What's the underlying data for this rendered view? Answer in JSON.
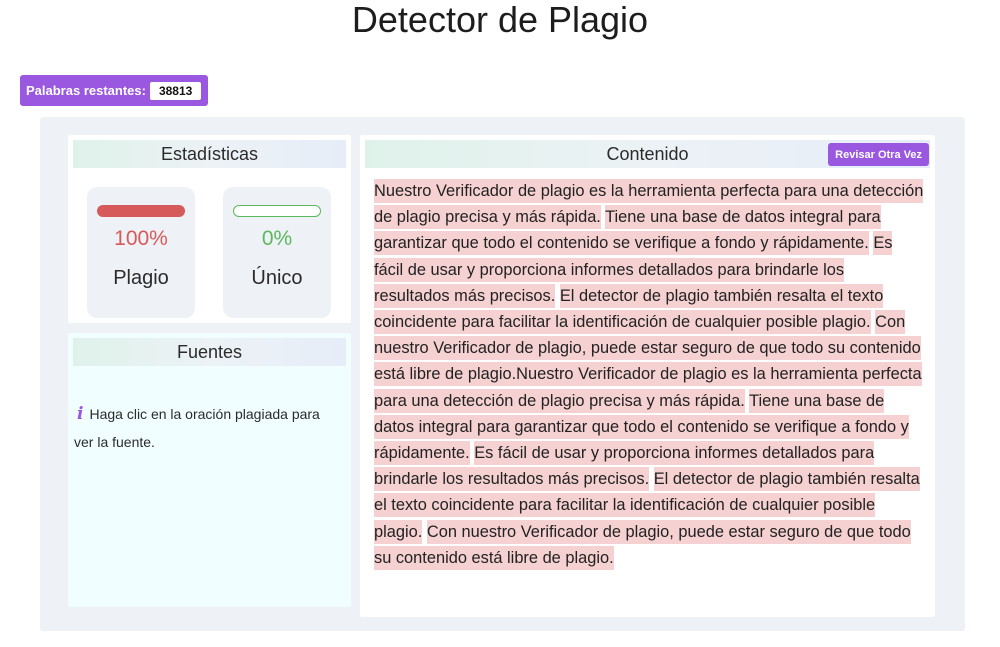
{
  "header": {
    "title": "Detector de Plagio"
  },
  "words_remaining": {
    "label": "Palabras restantes:",
    "count": "38813"
  },
  "stats": {
    "title": "Estadísticas",
    "plagio": {
      "percent": "100%",
      "label": "Plagio",
      "value": 1.0
    },
    "unico": {
      "percent": "0%",
      "label": "Único",
      "value": 0.0
    }
  },
  "sources": {
    "title": "Fuentes",
    "hint": "Haga clic en la oración plagiada para ver la fuente."
  },
  "content": {
    "title": "Contenido",
    "recheck_label": "Revisar Otra Vez",
    "sentences": [
      "Nuestro Verificador de plagio es la herramienta perfecta para una detección de plagio precisa y más rápida.",
      "Tiene una base de datos integral para garantizar que todo el contenido se verifique a fondo y rápidamente.",
      "Es fácil de usar y proporciona informes detallados para brindarle los resultados más precisos.",
      "El detector de plagio también resalta el texto coincidente para facilitar la identificación de cualquier posible plagio.",
      "Con nuestro Verificador de plagio, puede estar seguro de que todo su contenido está libre de plagio.",
      "Nuestro Verificador de plagio es la herramienta perfecta para una detección de plagio precisa y más rápida.",
      "Tiene una base de datos integral para garantizar que todo el contenido se verifique a fondo y rápidamente.",
      "Es fácil de usar y proporciona informes detallados para brindarle los resultados más precisos.",
      "El detector de plagio también resalta el texto coincidente para facilitar la identificación de cualquier posible plagio.",
      "Con nuestro Verificador de plagio, puede estar seguro de que todo su contenido está libre de plagio."
    ]
  },
  "colors": {
    "accent": "#9a57e0",
    "plagio": "#d65a5a",
    "unico": "#5cb85c",
    "highlight": "#f6d1d1"
  },
  "icons": {
    "info": "info-icon"
  }
}
